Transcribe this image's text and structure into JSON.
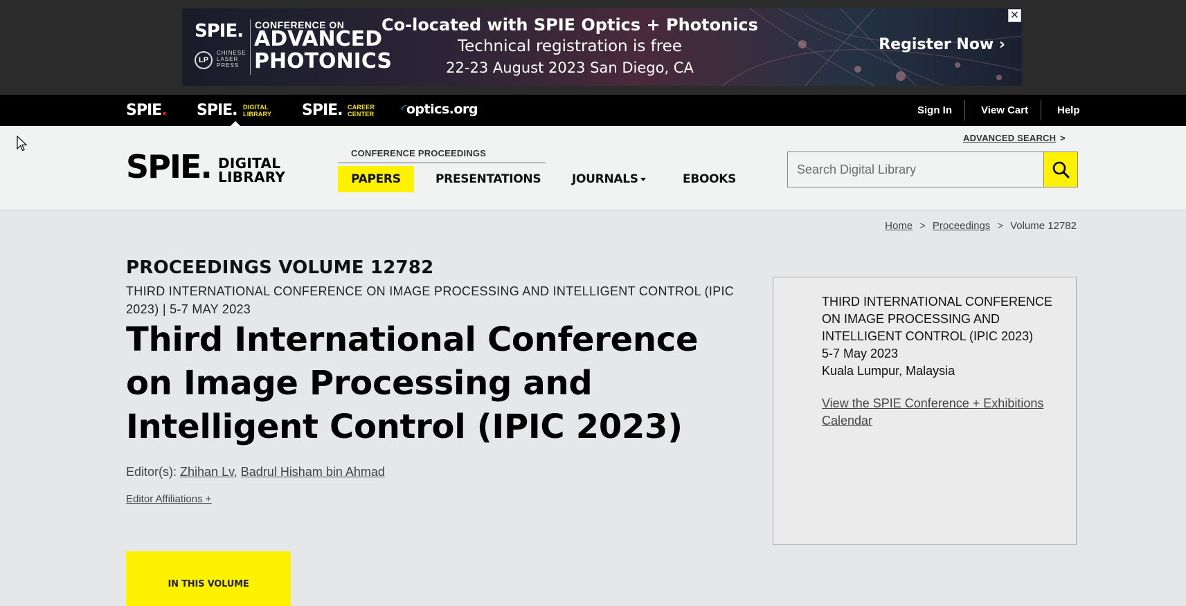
{
  "ad": {
    "spie": "SPIE.",
    "clp_mark": "LP",
    "clp_text": "CHINESE LASER PRESS",
    "conference_on": "CONFERENCE ON",
    "advanced": "ADVANCED",
    "photonics": "PHOTONICS",
    "line1": "Co-located with SPIE Optics + Photonics",
    "line2": "Technical registration is free",
    "line3": "22-23 August 2023 San Diego, CA",
    "register": "Register Now ›",
    "close": "✕"
  },
  "topnav": {
    "spie": "SPIE",
    "dl_brand": "SPIE.",
    "dl_sub1": "DIGITAL",
    "dl_sub2": "LIBRARY",
    "cc_brand": "SPIE.",
    "cc_sub1": "CAREER",
    "cc_sub2": "CENTER",
    "optics": "optics.org",
    "sign_in": "Sign In",
    "view_cart": "View Cart",
    "help": "Help"
  },
  "header": {
    "logo_spie": "SPIE.",
    "logo_dl1": "DIGITAL",
    "logo_dl2": "LIBRARY",
    "conference_proceedings": "CONFERENCE PROCEEDINGS",
    "nav": {
      "papers": "PAPERS",
      "presentations": "PRESENTATIONS",
      "journals": "JOURNALS",
      "ebooks": "EBOOKS"
    },
    "advanced_search": "ADVANCED SEARCH",
    "advanced_search_arrow": ">",
    "search_placeholder": "Search Digital Library"
  },
  "breadcrumb": {
    "home": "Home",
    "proceedings": "Proceedings",
    "current": "Volume 12782",
    "sep": ">"
  },
  "main": {
    "volume_label": "PROCEEDINGS VOLUME 12782",
    "conf_subtitle": "THIRD INTERNATIONAL CONFERENCE ON IMAGE PROCESSING AND INTELLIGENT CONTROL (IPIC 2023) | 5-7 MAY 2023",
    "title": "Third International Conference on Image Processing and Intelligent Control (IPIC 2023)",
    "editors_label": "Editor(s):",
    "editor1": "Zhihan Lv",
    "editor_sep": ",",
    "editor2": "Badrul Hisham bin Ahmad",
    "editor_affiliations": "Editor Affiliations +",
    "in_this_volume": "IN THIS VOLUME"
  },
  "side": {
    "conf_name": "THIRD INTERNATIONAL CONFERENCE ON IMAGE PROCESSING AND INTELLIGENT CONTROL (IPIC 2023)",
    "dates": "5-7 May 2023",
    "location": "Kuala Lumpur, Malaysia",
    "calendar_link": "View the SPIE Conference + Exhibitions Calendar"
  },
  "colors": {
    "accent": "#fff200",
    "topnav_bg": "#000000",
    "spie_dot": "#e31b23",
    "optics_arc": "#2fa3dc"
  }
}
